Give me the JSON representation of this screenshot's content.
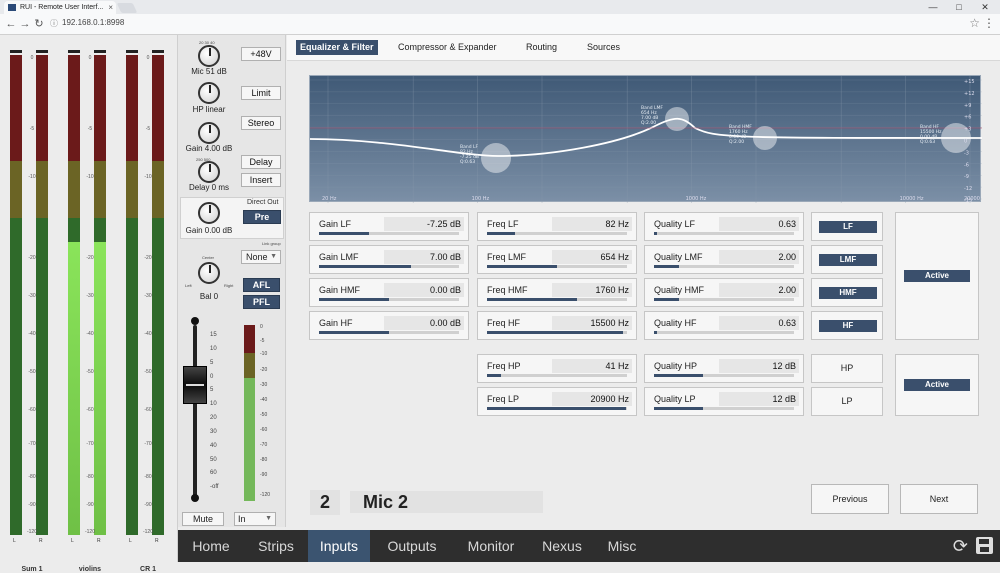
{
  "browser": {
    "tab_title": "RUI - Remote User Interf...",
    "tab_close": "×",
    "url": "192.168.0.1:8998",
    "url_prefix": "ⓘ",
    "back": "←",
    "forward": "→",
    "reload": "↻",
    "star": "☆",
    "menu": "⋮",
    "minimize": "—",
    "maximize": "□",
    "close": "✕"
  },
  "meters": {
    "scale": [
      "0",
      "-5",
      "-10",
      "-20",
      "-30",
      "-40",
      "-50",
      "-60",
      "-70",
      "-80",
      "-90",
      "-120"
    ],
    "channels": [
      {
        "name": "Sum 1",
        "left": "L",
        "right": "R",
        "level_l": 0,
        "level_r": 0
      },
      {
        "name": "violins",
        "left": "L",
        "right": "R",
        "level_l": 0.61,
        "level_r": 0.61
      },
      {
        "name": "CR 1",
        "left": "L",
        "right": "R",
        "level_l": 0,
        "level_r": 0
      }
    ]
  },
  "strip": {
    "knob_ticks_top": "20  30  40",
    "knob_ticks_side": "10      50",
    "knob_ticks_bot": "0       60",
    "mic_label": "Mic 51 dB",
    "hp_label": "HP linear",
    "gain_label": "Gain 4.00 dB",
    "delay_label": "Delay 0 ms",
    "delay_ticks": "250   500",
    "delay_ticks_bot": "0     1000",
    "gain2_label": "Gain 0.00 dB",
    "btn_48v": "+48V",
    "btn_limit": "Limit",
    "btn_stereo": "Stereo",
    "btn_delay": "Delay",
    "btn_insert": "Insert",
    "direct_out": "Direct Out",
    "btn_pre": "Pre",
    "link_group": "Link group",
    "link_value": "None",
    "bal_center": "Center",
    "bal_left": "Left",
    "bal_right": "Right",
    "bal_label": "Bal 0",
    "btn_afl": "AFL",
    "btn_pfl": "PFL",
    "fader_scale": [
      "15",
      "10",
      "5",
      "0",
      "5",
      "10",
      "20",
      "30",
      "40",
      "50",
      "60",
      "-off"
    ],
    "meter_scale": [
      "0",
      "-5",
      "-10",
      "-20",
      "-30",
      "-40",
      "-50",
      "-60",
      "-70",
      "-80",
      "-90",
      "-120"
    ],
    "btn_mute": "Mute",
    "insert_select": "In",
    "dropdown_arrow": "▼"
  },
  "subtabs": [
    "Equalizer & Filter",
    "Compressor & Expander",
    "Routing",
    "Sources"
  ],
  "eq_graph": {
    "freq_labels": [
      "20 Hz",
      "100 Hz",
      "1000 Hz",
      "10000 Hz",
      "20000 Hz"
    ],
    "db_labels": [
      "+15",
      "+12",
      "+9",
      "+6",
      "+3",
      "0",
      "-3",
      "-6",
      "-9",
      "-12",
      "-15"
    ],
    "nodes": [
      {
        "label": "Band LF",
        "l2": "82 Hz",
        "l3": "-7.25 dB",
        "l4": "Q:0.63"
      },
      {
        "label": "Band LMF",
        "l2": "654 Hz",
        "l3": "7.00 dB",
        "l4": "Q:2.00"
      },
      {
        "label": "Band HMF",
        "l2": "1760 Hz",
        "l3": "0.00 dB",
        "l4": "Q:2.00"
      },
      {
        "label": "Band HF",
        "l2": "15500 Hz",
        "l3": "0.00 dB",
        "l4": "Q:0.63"
      }
    ]
  },
  "params": {
    "gain": [
      {
        "name": "Gain LF",
        "value": "-7.25 dB",
        "fill": 0.36
      },
      {
        "name": "Gain LMF",
        "value": "7.00 dB",
        "fill": 0.66
      },
      {
        "name": "Gain HMF",
        "value": "0.00 dB",
        "fill": 0.5
      },
      {
        "name": "Gain HF",
        "value": "0.00 dB",
        "fill": 0.5
      }
    ],
    "freq": [
      {
        "name": "Freq LF",
        "value": "82 Hz",
        "fill": 0.2
      },
      {
        "name": "Freq LMF",
        "value": "654 Hz",
        "fill": 0.5
      },
      {
        "name": "Freq HMF",
        "value": "1760 Hz",
        "fill": 0.64
      },
      {
        "name": "Freq HF",
        "value": "15500 Hz",
        "fill": 0.97
      }
    ],
    "quality": [
      {
        "name": "Quality LF",
        "value": "0.63",
        "fill": 0.02
      },
      {
        "name": "Quality LMF",
        "value": "2.00",
        "fill": 0.18
      },
      {
        "name": "Quality HMF",
        "value": "2.00",
        "fill": 0.18
      },
      {
        "name": "Quality HF",
        "value": "0.63",
        "fill": 0.02
      }
    ],
    "filters": [
      {
        "name": "Freq HP",
        "value": "41 Hz",
        "fill": 0.1
      },
      {
        "name": "Freq LP",
        "value": "20900 Hz",
        "fill": 0.99
      }
    ],
    "filter_quality": [
      {
        "name": "Quality HP",
        "value": "12 dB",
        "fill": 0.35
      },
      {
        "name": "Quality LP",
        "value": "12 dB",
        "fill": 0.35
      }
    ]
  },
  "bands": [
    "LF",
    "LMF",
    "HMF",
    "HF"
  ],
  "filter_bands": [
    "HP",
    "LP"
  ],
  "eq_active": "Active",
  "filter_active": "Active",
  "channel": {
    "number": "2",
    "name": "Mic  2"
  },
  "nav": {
    "previous": "Previous",
    "next": "Next"
  },
  "footer": {
    "items": [
      "Home",
      "Strips",
      "Inputs",
      "Outputs",
      "Monitor",
      "Nexus",
      "Misc"
    ],
    "active": "Inputs",
    "refresh": "⟳"
  },
  "colors": {
    "accent": "#3a4f6c",
    "meter_green": "#8ae45a",
    "footer_bg": "#2e2e2e"
  }
}
